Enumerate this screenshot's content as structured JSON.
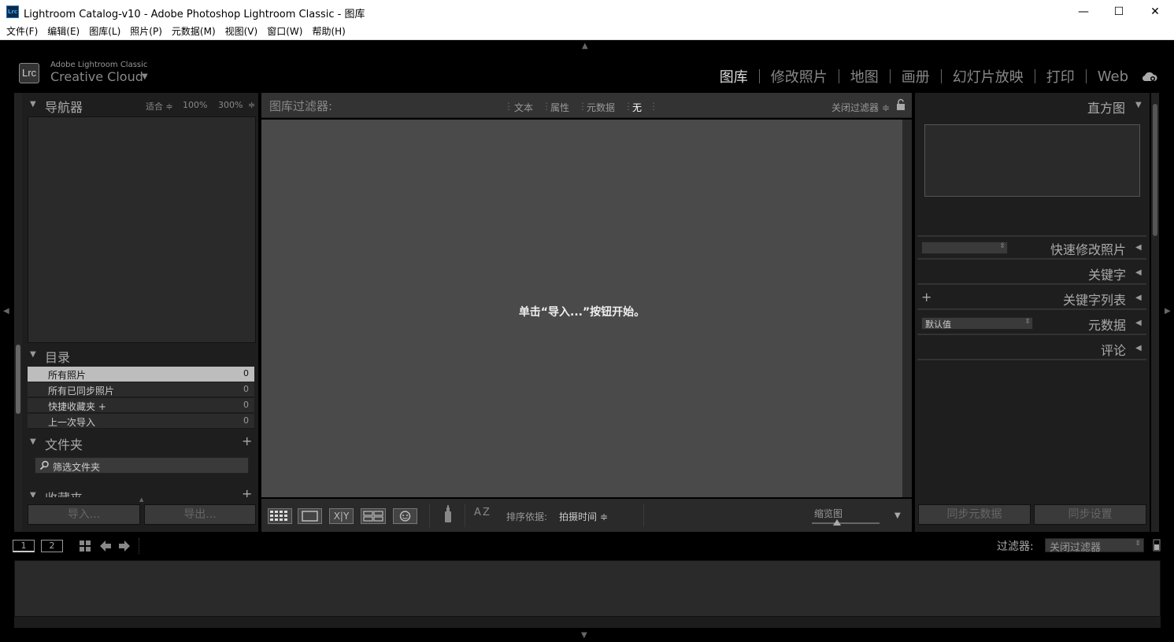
{
  "window": {
    "app_icon": "Lrc",
    "title": "Lightroom Catalog-v10 - Adobe Photoshop Lightroom Classic - 图库",
    "min_glyph": "—",
    "max_glyph": "☐",
    "close_glyph": "✕"
  },
  "menu": [
    "文件(F)",
    "编辑(E)",
    "图库(L)",
    "照片(P)",
    "元数据(M)",
    "视图(V)",
    "窗口(W)",
    "帮助(H)"
  ],
  "identity": {
    "badge": "Lrc",
    "small": "Adobe Lightroom Classic",
    "big": "Creative Cloud"
  },
  "modules": [
    {
      "label": "图库",
      "active": true
    },
    {
      "label": "修改照片",
      "active": false
    },
    {
      "label": "地图",
      "active": false
    },
    {
      "label": "画册",
      "active": false
    },
    {
      "label": "幻灯片放映",
      "active": false
    },
    {
      "label": "打印",
      "active": false
    },
    {
      "label": "Web",
      "active": false
    }
  ],
  "left": {
    "navigator": {
      "title": "导航器",
      "fit": "适合 ≑",
      "zoom100": "100%",
      "zoom300": "300%",
      "zoom_arrow": "≑"
    },
    "catalog": {
      "title": "目录",
      "items": [
        {
          "label": "所有照片",
          "count": "0"
        },
        {
          "label": "所有已同步照片",
          "count": "0"
        },
        {
          "label": "快捷收藏夹 +",
          "count": "0"
        },
        {
          "label": "上一次导入",
          "count": "0"
        }
      ]
    },
    "folders": {
      "title": "文件夹",
      "add": "+",
      "search_placeholder": "筛选文件夹"
    },
    "collections": {
      "title": "收藏夹",
      "add": "+"
    },
    "import_label": "导入...",
    "export_label": "导出..."
  },
  "filterbar": {
    "label": "图库过滤器:",
    "options": [
      "文本",
      "属性",
      "元数据",
      "无"
    ],
    "preset": "关闭过滤器 ≑"
  },
  "grid": {
    "message": "单击“导入...”按钮开始。"
  },
  "toolbar": {
    "sort_label": "排序依据:",
    "sort_value": "拍摄时间 ≑",
    "thumb_label": "缩览图",
    "thumb_level": 0.2,
    "compare_label": "X|Y",
    "az_label": "A Z"
  },
  "right": {
    "histogram": {
      "title": "直方图"
    },
    "quick_develop": {
      "title": "快速修改照片"
    },
    "keywording": {
      "title": "关键字"
    },
    "keyword_list": {
      "title": "关键字列表",
      "add": "+"
    },
    "metadata": {
      "title": "元数据",
      "preset": "默认值"
    },
    "comments": {
      "title": "评论"
    },
    "sync_metadata": "同步元数据",
    "sync_settings": "同步设置"
  },
  "filmstrip": {
    "screen1": "1",
    "screen2": "2",
    "filter_label": "过滤器:",
    "filter_value": "关闭过滤器"
  },
  "colors": {
    "panel_bg": "#1e1e1e",
    "grid_bg": "#4a4a4a",
    "active_text": "#dddddd"
  }
}
